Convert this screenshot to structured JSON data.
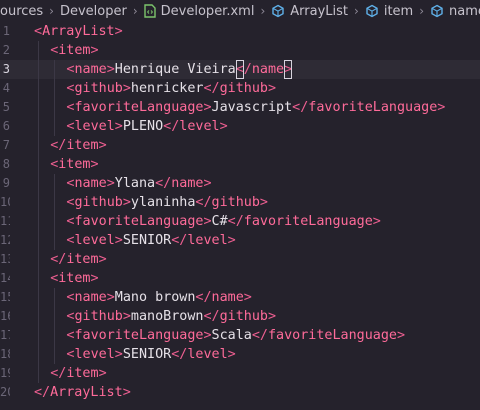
{
  "breadcrumb": {
    "items": [
      {
        "label": "ources",
        "icon": ""
      },
      {
        "label": "Developer",
        "icon": ""
      },
      {
        "label": "Developer.xml",
        "icon": "xml-file-icon"
      },
      {
        "label": "ArrayList",
        "icon": "element-icon"
      },
      {
        "label": "item",
        "icon": "element-icon"
      },
      {
        "label": "name",
        "icon": "element-icon"
      }
    ]
  },
  "editor": {
    "active_line": 3,
    "lines": [
      {
        "num": "1",
        "indent": 0,
        "tag": "ArrayList",
        "kind": "open"
      },
      {
        "num": "2",
        "indent": 1,
        "tag": "item",
        "kind": "open"
      },
      {
        "num": "3",
        "indent": 2,
        "tag": "name",
        "kind": "element",
        "value": "Henrique Vieira"
      },
      {
        "num": "4",
        "indent": 2,
        "tag": "github",
        "kind": "element",
        "value": "henricker"
      },
      {
        "num": "5",
        "indent": 2,
        "tag": "favoriteLanguage",
        "kind": "element",
        "value": "Javascript"
      },
      {
        "num": "6",
        "indent": 2,
        "tag": "level",
        "kind": "element",
        "value": "PLENO"
      },
      {
        "num": "7",
        "indent": 1,
        "tag": "item",
        "kind": "close"
      },
      {
        "num": "8",
        "indent": 1,
        "tag": "item",
        "kind": "open"
      },
      {
        "num": "9",
        "indent": 2,
        "tag": "name",
        "kind": "element",
        "value": "Ylana"
      },
      {
        "num": "10",
        "indent": 2,
        "tag": "github",
        "kind": "element",
        "value": "ylaninha"
      },
      {
        "num": "11",
        "indent": 2,
        "tag": "favoriteLanguage",
        "kind": "element",
        "value": "C#"
      },
      {
        "num": "12",
        "indent": 2,
        "tag": "level",
        "kind": "element",
        "value": "SENIOR"
      },
      {
        "num": "13",
        "indent": 1,
        "tag": "item",
        "kind": "close"
      },
      {
        "num": "14",
        "indent": 1,
        "tag": "item",
        "kind": "open"
      },
      {
        "num": "15",
        "indent": 2,
        "tag": "name",
        "kind": "element",
        "value": "Mano brown"
      },
      {
        "num": "16",
        "indent": 2,
        "tag": "github",
        "kind": "element",
        "value": "manoBrown"
      },
      {
        "num": "17",
        "indent": 2,
        "tag": "favoriteLanguage",
        "kind": "element",
        "value": "Scala"
      },
      {
        "num": "18",
        "indent": 2,
        "tag": "level",
        "kind": "element",
        "value": "SENIOR"
      },
      {
        "num": "19",
        "indent": 1,
        "tag": "item",
        "kind": "close"
      },
      {
        "num": "20",
        "indent": 0,
        "tag": "ArrayList",
        "kind": "close"
      }
    ]
  },
  "colors": {
    "background": "#25222c",
    "tag": "#ff6b9a",
    "text": "#e6e1e8",
    "line_number": "#6b6677"
  }
}
